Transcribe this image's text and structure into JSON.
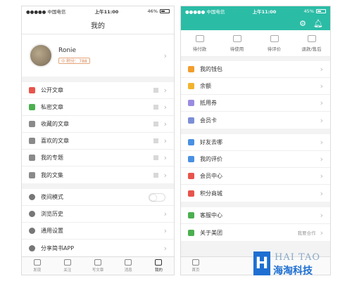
{
  "left": {
    "status": {
      "carrier": "●●●●● 中国电信",
      "time": "上午11:00",
      "battery": "46%"
    },
    "title": "我的",
    "profile": {
      "name": "Ronie",
      "points": "积分：788"
    },
    "group1": [
      {
        "label": "公开文章",
        "icon": "document-icon",
        "color": "#e8544c"
      },
      {
        "label": "私密文章",
        "icon": "lock-icon",
        "color": "#4caf50"
      },
      {
        "label": "收藏的文章",
        "icon": "bookmark-icon",
        "color": "#8a8a8a"
      },
      {
        "label": "喜欢的文章",
        "icon": "heart-icon",
        "color": "#8a8a8a"
      },
      {
        "label": "我的专题",
        "icon": "grid-icon",
        "color": "#8a8a8a"
      },
      {
        "label": "我的文集",
        "icon": "books-icon",
        "color": "#8a8a8a"
      }
    ],
    "group2": [
      {
        "label": "夜间模式",
        "icon": "moon-icon"
      },
      {
        "label": "浏览历史",
        "icon": "clock-icon"
      },
      {
        "label": "通用设置",
        "icon": "gear-icon"
      },
      {
        "label": "分享简书APP",
        "icon": "share-icon"
      }
    ],
    "tabs": [
      {
        "label": "发现",
        "icon": "compass-icon"
      },
      {
        "label": "关注",
        "icon": "follow-icon"
      },
      {
        "label": "写文章",
        "icon": "write-icon"
      },
      {
        "label": "消息",
        "icon": "bell-icon"
      },
      {
        "label": "我的",
        "icon": "user-icon"
      }
    ]
  },
  "right": {
    "status": {
      "carrier": "●●●●● 中国电信",
      "time": "上午11:00",
      "battery": "45%"
    },
    "orders": [
      {
        "label": "待付款",
        "icon": "wallet-icon"
      },
      {
        "label": "待使用",
        "icon": "ticket-icon"
      },
      {
        "label": "待评价",
        "icon": "comment-icon"
      },
      {
        "label": "退款/售后",
        "icon": "refund-icon"
      }
    ],
    "group1": [
      {
        "label": "我的钱包",
        "icon": "wallet-icon",
        "color": "#f29d2c"
      },
      {
        "label": "余额",
        "icon": "coin-icon",
        "color": "#f2b32c"
      },
      {
        "label": "抵用券",
        "icon": "coupon-icon",
        "color": "#9b8be0"
      },
      {
        "label": "会员卡",
        "icon": "vip-icon",
        "color": "#7c8fd6"
      }
    ],
    "group2": [
      {
        "label": "好友去哪",
        "icon": "person-icon",
        "color": "#4a90e2"
      },
      {
        "label": "我的评价",
        "icon": "chat-icon",
        "color": "#4a90e2"
      },
      {
        "label": "会员中心",
        "icon": "crown-icon",
        "color": "#e8544c"
      },
      {
        "label": "积分商城",
        "icon": "bag-icon",
        "color": "#e8544c"
      }
    ],
    "group3": [
      {
        "label": "客服中心",
        "icon": "phone-icon",
        "color": "#4caf50",
        "right": ""
      },
      {
        "label": "关于美团",
        "icon": "tooth-icon",
        "color": "#4caf50",
        "right": "我要合作"
      }
    ],
    "tabs": [
      {
        "label": "首页",
        "icon": "home-icon"
      }
    ]
  },
  "watermark": {
    "mark": "H",
    "en": "HAI TAO",
    "cn": "海淘科技"
  }
}
